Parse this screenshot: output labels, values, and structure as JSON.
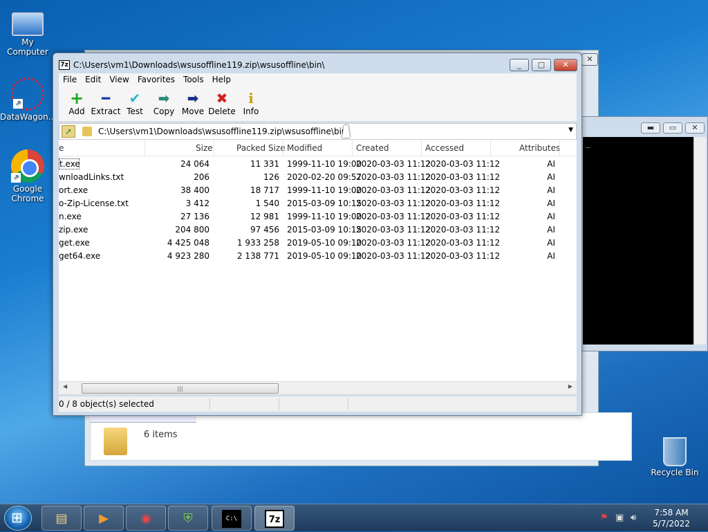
{
  "desktop": {
    "icons": [
      {
        "label": "My Computer",
        "icon": "computer-icon"
      },
      {
        "label": "DataWagon...",
        "icon": "datawagon-icon"
      },
      {
        "label": "Google Chrome",
        "icon": "chrome-icon"
      },
      {
        "label": "Recycle Bin",
        "icon": "recycle-bin-icon"
      }
    ]
  },
  "background_explorer": {
    "status": "6 items"
  },
  "console_window": {
    "prompt": "_"
  },
  "window": {
    "title": "C:\\Users\\vm1\\Downloads\\wsusoffline119.zip\\wsusoffline\\bin\\",
    "icon_label": "7z",
    "controls": {
      "minimize": "_",
      "maximize": "□",
      "close": "✕"
    },
    "menu": [
      "File",
      "Edit",
      "View",
      "Favorites",
      "Tools",
      "Help"
    ],
    "toolbar": [
      {
        "label": "Add",
        "glyph": "+",
        "color": "#1fa71f",
        "icon": "add-icon"
      },
      {
        "label": "Extract",
        "glyph": "━",
        "color": "#1b3fa8",
        "icon": "extract-icon"
      },
      {
        "label": "Test",
        "glyph": "✔",
        "color": "#2bb7c7",
        "icon": "test-icon"
      },
      {
        "label": "Copy",
        "glyph": "➡",
        "color": "#2a8a7a",
        "icon": "copy-icon"
      },
      {
        "label": "Move",
        "glyph": "➡",
        "color": "#1b2f88",
        "icon": "move-icon"
      },
      {
        "label": "Delete",
        "glyph": "✖",
        "color": "#d22020",
        "icon": "delete-icon"
      },
      {
        "label": "Info",
        "glyph": "i",
        "color": "#c9a000",
        "icon": "info-icon"
      }
    ],
    "address": "C:\\Users\\vm1\\Downloads\\wsusoffline119.zip\\wsusoffline\\bin\\",
    "columns": [
      "e",
      "Size",
      "Packed Size",
      "Modified",
      "Created",
      "Accessed",
      "Attributes"
    ],
    "rows": [
      {
        "name": "t.exe",
        "size": "24 064",
        "packed": "11 331",
        "modified": "1999-11-10 19:00",
        "created": "2020-03-03 11:12",
        "accessed": "2020-03-03 11:12",
        "attr": "AI"
      },
      {
        "name": "wnloadLinks.txt",
        "size": "206",
        "packed": "126",
        "modified": "2020-02-20 09:57",
        "created": "2020-03-03 11:12",
        "accessed": "2020-03-03 11:12",
        "attr": "AI"
      },
      {
        "name": "ort.exe",
        "size": "38 400",
        "packed": "18 717",
        "modified": "1999-11-10 19:00",
        "created": "2020-03-03 11:12",
        "accessed": "2020-03-03 11:12",
        "attr": "AI"
      },
      {
        "name": "o-Zip-License.txt",
        "size": "3 412",
        "packed": "1 540",
        "modified": "2015-03-09 10:15",
        "created": "2020-03-03 11:12",
        "accessed": "2020-03-03 11:12",
        "attr": "AI"
      },
      {
        "name": "n.exe",
        "size": "27 136",
        "packed": "12 981",
        "modified": "1999-11-10 19:00",
        "created": "2020-03-03 11:12",
        "accessed": "2020-03-03 11:12",
        "attr": "AI"
      },
      {
        "name": "zip.exe",
        "size": "204 800",
        "packed": "97 456",
        "modified": "2015-03-09 10:15",
        "created": "2020-03-03 11:12",
        "accessed": "2020-03-03 11:12",
        "attr": "AI"
      },
      {
        "name": "get.exe",
        "size": "4 425 048",
        "packed": "1 933 258",
        "modified": "2019-05-10 09:10",
        "created": "2020-03-03 11:12",
        "accessed": "2020-03-03 11:12",
        "attr": "AI"
      },
      {
        "name": "get64.exe",
        "size": "4 923 280",
        "packed": "2 138 771",
        "modified": "2019-05-10 09:10",
        "created": "2020-03-03 11:12",
        "accessed": "2020-03-03 11:12",
        "attr": "AI"
      }
    ],
    "status": "0 / 8 object(s) selected"
  },
  "taskbar": {
    "buttons": [
      {
        "icon": "explorer-icon",
        "glyph": "▤"
      },
      {
        "icon": "media-player-icon",
        "glyph": "▶"
      },
      {
        "icon": "chrome-icon",
        "glyph": "◉"
      },
      {
        "icon": "shield-icon",
        "glyph": "⛨"
      },
      {
        "icon": "cmd-icon",
        "glyph": "C:\\"
      },
      {
        "icon": "7zip-icon",
        "glyph": "7z"
      }
    ],
    "time": "7:58 AM",
    "date": "5/7/2022"
  }
}
